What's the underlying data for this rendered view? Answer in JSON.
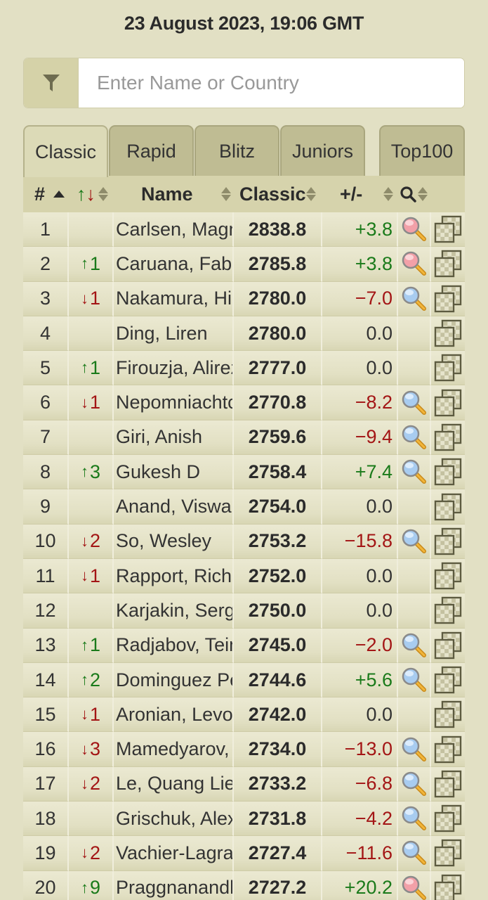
{
  "header": {
    "date": "23 August 2023, 19:06 GMT"
  },
  "search": {
    "placeholder": "Enter Name or Country",
    "value": ""
  },
  "tabs": [
    {
      "label": "Classic",
      "active": true
    },
    {
      "label": "Rapid",
      "active": false
    },
    {
      "label": "Blitz",
      "active": false
    },
    {
      "label": "Juniors",
      "active": false
    },
    {
      "label": "Top100",
      "active": false
    }
  ],
  "columns": {
    "rank": "#",
    "change_up": "↑",
    "change_down": "↓",
    "name": "Name",
    "rating": "Classic",
    "diff": "+/-",
    "q": "Q"
  },
  "colors": {
    "up": "#1a7a1a",
    "down": "#a31515",
    "background": "#e2e0c4"
  },
  "rows": [
    {
      "rank": "1",
      "change": "",
      "dir": "",
      "name": "Carlsen, Magnus",
      "rating": "2838.8",
      "diff": "+3.8",
      "live": "pink"
    },
    {
      "rank": "2",
      "change": "1",
      "dir": "up",
      "name": "Caruana, Fabiano",
      "rating": "2785.8",
      "diff": "+3.8",
      "live": "pink"
    },
    {
      "rank": "3",
      "change": "1",
      "dir": "down",
      "name": "Nakamura, Hikaru",
      "rating": "2780.0",
      "diff": "−7.0",
      "live": "blue"
    },
    {
      "rank": "4",
      "change": "",
      "dir": "",
      "name": "Ding, Liren",
      "rating": "2780.0",
      "diff": "0.0",
      "live": ""
    },
    {
      "rank": "5",
      "change": "1",
      "dir": "up",
      "name": "Firouzja, Alireza",
      "rating": "2777.0",
      "diff": "0.0",
      "live": ""
    },
    {
      "rank": "6",
      "change": "1",
      "dir": "down",
      "name": "Nepomniachtchi, Ian",
      "rating": "2770.8",
      "diff": "−8.2",
      "live": "blue"
    },
    {
      "rank": "7",
      "change": "",
      "dir": "",
      "name": "Giri, Anish",
      "rating": "2759.6",
      "diff": "−9.4",
      "live": "blue"
    },
    {
      "rank": "8",
      "change": "3",
      "dir": "up",
      "name": "Gukesh D",
      "rating": "2758.4",
      "diff": "+7.4",
      "live": "blue"
    },
    {
      "rank": "9",
      "change": "",
      "dir": "",
      "name": "Anand, Viswanathan",
      "rating": "2754.0",
      "diff": "0.0",
      "live": ""
    },
    {
      "rank": "10",
      "change": "2",
      "dir": "down",
      "name": "So, Wesley",
      "rating": "2753.2",
      "diff": "−15.8",
      "live": "blue"
    },
    {
      "rank": "11",
      "change": "1",
      "dir": "down",
      "name": "Rapport, Richard",
      "rating": "2752.0",
      "diff": "0.0",
      "live": ""
    },
    {
      "rank": "12",
      "change": "",
      "dir": "",
      "name": "Karjakin, Sergey",
      "rating": "2750.0",
      "diff": "0.0",
      "live": ""
    },
    {
      "rank": "13",
      "change": "1",
      "dir": "up",
      "name": "Radjabov, Teimour",
      "rating": "2745.0",
      "diff": "−2.0",
      "live": "blue"
    },
    {
      "rank": "14",
      "change": "2",
      "dir": "up",
      "name": "Dominguez Perez, Leinier",
      "rating": "2744.6",
      "diff": "+5.6",
      "live": "blue"
    },
    {
      "rank": "15",
      "change": "1",
      "dir": "down",
      "name": "Aronian, Levon",
      "rating": "2742.0",
      "diff": "0.0",
      "live": ""
    },
    {
      "rank": "16",
      "change": "3",
      "dir": "down",
      "name": "Mamedyarov, Shakhriyar",
      "rating": "2734.0",
      "diff": "−13.0",
      "live": "blue"
    },
    {
      "rank": "17",
      "change": "2",
      "dir": "down",
      "name": "Le, Quang Liem",
      "rating": "2733.2",
      "diff": "−6.8",
      "live": "blue"
    },
    {
      "rank": "18",
      "change": "",
      "dir": "",
      "name": "Grischuk, Alexander",
      "rating": "2731.8",
      "diff": "−4.2",
      "live": "blue"
    },
    {
      "rank": "19",
      "change": "2",
      "dir": "down",
      "name": "Vachier-Lagrave, Maxime",
      "rating": "2727.4",
      "diff": "−11.6",
      "live": "blue"
    },
    {
      "rank": "20",
      "change": "9",
      "dir": "up",
      "name": "Praggnanandhaa R",
      "rating": "2727.2",
      "diff": "+20.2",
      "live": "pink"
    }
  ]
}
